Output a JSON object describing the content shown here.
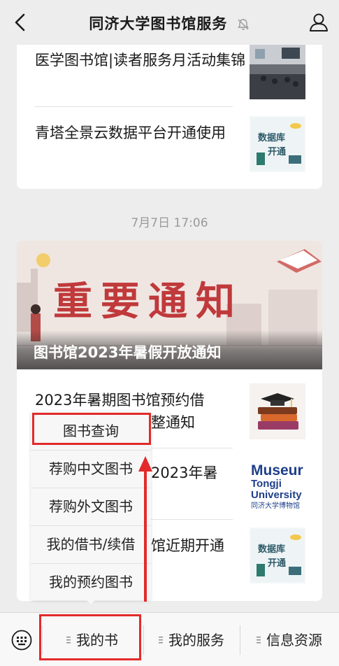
{
  "header": {
    "title": "同济大学图书馆服务"
  },
  "feed": {
    "card1": {
      "items": [
        {
          "text": "医学图书馆|读者服务月活动集锦"
        },
        {
          "text": "青塔全景云数据平台开通使用",
          "thumb_text_1": "数据库",
          "thumb_text_2": "开通"
        }
      ]
    },
    "timestamp": "7月7日 17:06",
    "card2": {
      "banner_big": "重要通知",
      "banner_caption": "图书馆2023年暑假开放通知",
      "items": [
        {
          "text_a": "2023年暑期图书馆预约借",
          "text_b": "整通知"
        },
        {
          "text": "2023年暑",
          "thumb_line1": "Museur",
          "thumb_line2": "Tongji",
          "thumb_line3": "University",
          "thumb_line4": "同济大学博物馆"
        },
        {
          "text": "馆近期开通",
          "thumb_text_1": "数据库",
          "thumb_text_2": "开通"
        }
      ]
    }
  },
  "popup_menu": {
    "items": [
      {
        "label": "图书查询"
      },
      {
        "label": "荐购中文图书"
      },
      {
        "label": "荐购外文图书"
      },
      {
        "label": "我的借书/续借"
      },
      {
        "label": "我的预约图书"
      }
    ]
  },
  "bottom_bar": {
    "tabs": [
      {
        "label": "我的书"
      },
      {
        "label": "我的服务"
      },
      {
        "label": "信息资源"
      }
    ]
  },
  "colors": {
    "highlight": "#e32a2a",
    "banner_red": "#c0393b"
  }
}
